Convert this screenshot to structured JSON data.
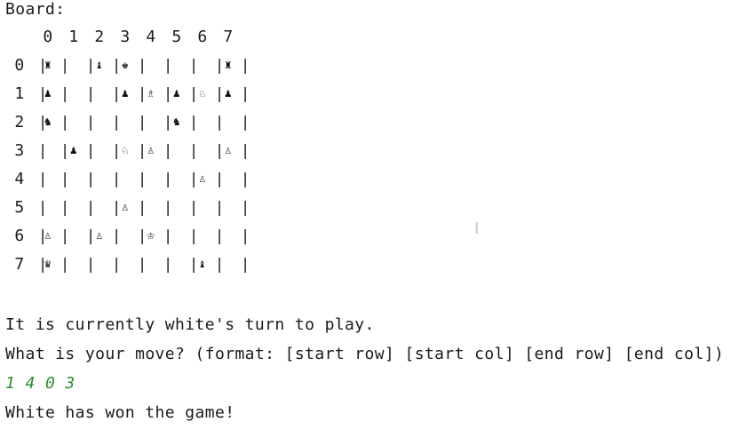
{
  "board_label": "Board:",
  "columns": [
    "0",
    "1",
    "2",
    "3",
    "4",
    "5",
    "6",
    "7"
  ],
  "rows": [
    {
      "label": "0",
      "cells": [
        "♜",
        "",
        "♝",
        "♚",
        "",
        "",
        "",
        "♜"
      ]
    },
    {
      "label": "1",
      "cells": [
        "♟",
        "",
        "",
        "♟",
        "♗",
        "♟",
        "♘",
        "♟"
      ]
    },
    {
      "label": "2",
      "cells": [
        "♞",
        "",
        "",
        "",
        "",
        "♞",
        "",
        ""
      ]
    },
    {
      "label": "3",
      "cells": [
        "",
        "♟",
        "",
        "♘",
        "♙",
        "",
        "",
        "♙"
      ]
    },
    {
      "label": "4",
      "cells": [
        "",
        "",
        "",
        "",
        "",
        "",
        "♙",
        ""
      ]
    },
    {
      "label": "5",
      "cells": [
        "",
        "",
        "",
        "♙",
        "",
        "",
        "",
        ""
      ]
    },
    {
      "label": "6",
      "cells": [
        "♙",
        "",
        "♙",
        "",
        "♔",
        "",
        "",
        ""
      ]
    },
    {
      "label": "7",
      "cells": [
        "♛",
        "",
        "",
        "",
        "",
        "",
        "♝",
        ""
      ]
    }
  ],
  "turn_message": "It is currently white's turn to play.",
  "prompt": "What is your move? (format: [start row] [start col] [end row] [end col])",
  "user_input": "1 4 0 3",
  "result_message": "White has won the game!",
  "cursor_glyph": "I",
  "colors": {
    "input": "#2e8b2e",
    "text": "#1a1a1a"
  }
}
